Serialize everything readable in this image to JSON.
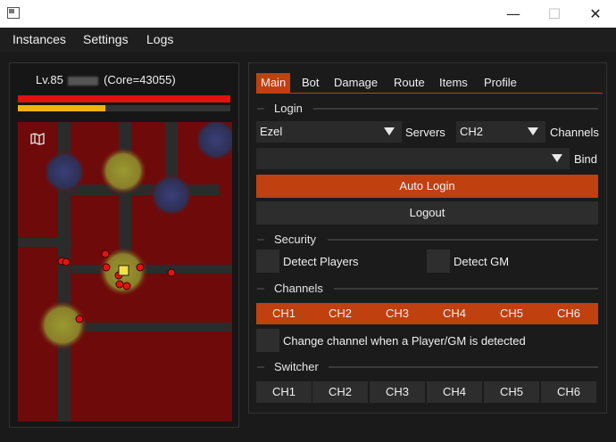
{
  "window": {
    "minimize_glyph": "—",
    "maximize_glyph": "☐",
    "close_glyph": "✕"
  },
  "menu": [
    "Instances",
    "Settings",
    "Logs"
  ],
  "character": {
    "level_text": "Lv.85",
    "core_text": "(Core=43055)",
    "hp_fraction": 1.0,
    "mp_fraction": 0.41
  },
  "map_icon": "map-icon",
  "tabs": [
    "Main",
    "Bot",
    "Damage",
    "Route",
    "Items",
    "Profile"
  ],
  "login": {
    "section": "Login",
    "character_value": "Ezel",
    "servers_label": "Servers",
    "server_value": "CH2",
    "channels_label": "Channels",
    "bind_value": "",
    "bind_label": "Bind",
    "auto_login": "Auto Login",
    "logout": "Logout"
  },
  "security": {
    "section": "Security",
    "detect_players": "Detect Players",
    "detect_gm": "Detect GM"
  },
  "channels": {
    "section": "Channels",
    "items": [
      "CH1",
      "CH2",
      "CH3",
      "CH4",
      "CH5",
      "CH6"
    ],
    "change_text": "Change channel when a Player/GM is detected"
  },
  "switcher": {
    "section": "Switcher",
    "items": [
      "CH1",
      "CH2",
      "CH3",
      "CH4",
      "CH5",
      "CH6"
    ]
  },
  "colors": {
    "accent": "#c0400f",
    "hp": "#e31010",
    "mp": "#f2b40c"
  }
}
